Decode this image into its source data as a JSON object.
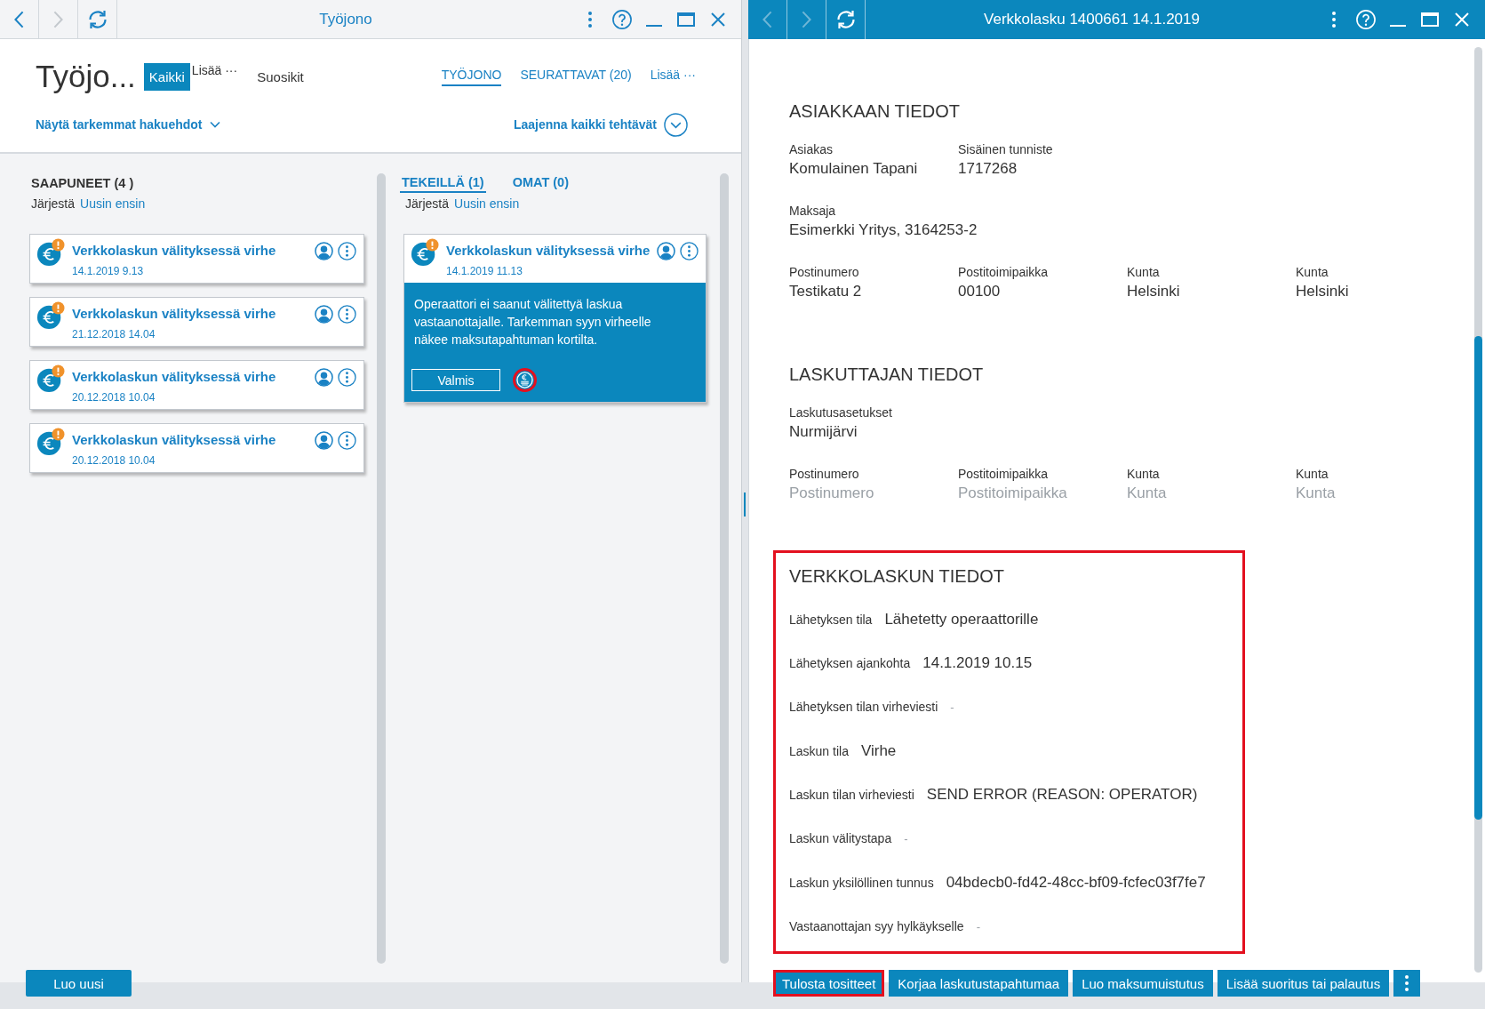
{
  "queue_window": {
    "title_bar": {
      "title": "Työjono",
      "active": false,
      "nav": [
        {
          "kind": "back",
          "disabled": false
        },
        {
          "kind": "forward",
          "disabled": true
        }
      ]
    },
    "header": {
      "title": "Työjo...",
      "view_tabs": [
        {
          "kind": "tab",
          "label": "Kaikki",
          "selected": true
        },
        {
          "kind": "more",
          "label": "Lisää ···",
          "selected": false
        },
        {
          "kind": "tab",
          "label": "Suosikit",
          "selected": false
        }
      ],
      "queue_tabs": [
        {
          "label": "TYÖJONO",
          "selected": true
        },
        {
          "label": "SEURATTAVAT (20)",
          "selected": false
        },
        {
          "label": "Lisää ···",
          "selected": false
        }
      ],
      "filter_link": "Näytä tarkemmat hakuehdot",
      "expand_link": "Laajenna kaikki tehtävät"
    },
    "columns": [
      {
        "kind": "heading",
        "heading": "SAAPUNEET (4 )",
        "sort_label": "Järjestä",
        "sort_value": "Uusin ensin",
        "cards": [
          {
            "title": "Verkkolaskun välityksessä virhe",
            "date": "14.1.2019 9.13"
          },
          {
            "title": "Verkkolaskun välityksessä virhe",
            "date": "21.12.2018 14.04"
          },
          {
            "title": "Verkkolaskun välityksessä virhe",
            "date": "20.12.2018 10.04"
          },
          {
            "title": "Verkkolaskun välityksessä virhe",
            "date": "20.12.2018 10.04"
          }
        ]
      },
      {
        "kind": "tabs",
        "tabs": [
          {
            "label": "TEKEILLÄ (1)",
            "selected": true
          },
          {
            "label": "OMAT (0)",
            "selected": false
          }
        ],
        "sort_label": "Järjestä",
        "sort_value": "Uusin ensin",
        "cards": [
          {
            "title": "Verkkolaskun välityksessä virhe",
            "date": "14.1.2019 11.13",
            "expanded": true,
            "message": "Operaattori ei saanut välitettyä laskua vastaanottajalle. Tarkemman syyn virheelle näkee maksutapahtuman kortilta.",
            "done_button": "Valmis",
            "action_highlighted": true
          }
        ]
      }
    ],
    "new_button": "Luo uusi"
  },
  "detail_window": {
    "title_bar": {
      "title": "Verkkolasku 1400661 14.1.2019",
      "active": true,
      "nav": [
        {
          "kind": "back",
          "disabled": true
        },
        {
          "kind": "forward",
          "disabled": true
        }
      ]
    },
    "sections": [
      {
        "kind": "grid",
        "title": "ASIAKKAAN TIEDOT",
        "highlighted": false,
        "rows": [
          [
            {
              "kind": "text",
              "label": "Asiakas",
              "value": "Komulainen Tapani"
            },
            {
              "kind": "text",
              "label": "Sisäinen tunniste",
              "value": "1717268"
            }
          ],
          [
            {
              "kind": "text",
              "label": "Maksaja",
              "value": "Esimerkki Yritys, 3164253-2"
            }
          ],
          [
            {
              "kind": "text",
              "label": "Postinumero",
              "value": "Testikatu 2"
            },
            {
              "kind": "text",
              "label": "Postitoimipaikka",
              "value": "00100"
            },
            {
              "kind": "text",
              "label": "Kunta",
              "value": "Helsinki"
            },
            {
              "kind": "text",
              "label": "Kunta",
              "value": "Helsinki"
            }
          ]
        ]
      },
      {
        "kind": "grid",
        "title": "LASKUTTAJAN TIEDOT",
        "highlighted": false,
        "rows": [
          [
            {
              "kind": "text",
              "label": "Laskutusasetukset",
              "value": "Nurmijärvi"
            }
          ],
          [
            {
              "kind": "input",
              "label": "Postinumero",
              "placeholder": "Postinumero"
            },
            {
              "kind": "input",
              "label": "Postitoimipaikka",
              "placeholder": "Postitoimipaikka"
            },
            {
              "kind": "input",
              "label": "Kunta",
              "placeholder": "Kunta"
            },
            {
              "kind": "input",
              "label": "Kunta",
              "placeholder": "Kunta"
            }
          ]
        ]
      },
      {
        "kind": "list",
        "title": "VERKKOLASKUN TIEDOT",
        "highlighted": true,
        "fields": [
          {
            "kind": "text",
            "label": "Lähetyksen tila",
            "value": "Lähetetty operaattorille"
          },
          {
            "kind": "text",
            "label": "Lähetyksen ajankohta",
            "value": "14.1.2019 10.15"
          },
          {
            "kind": "blank",
            "label": "Lähetyksen tilan virheviesti",
            "value": "-"
          },
          {
            "kind": "text",
            "label": "Laskun tila",
            "value": "Virhe"
          },
          {
            "kind": "text",
            "label": "Laskun tilan virheviesti",
            "value": "SEND ERROR (REASON: OPERATOR)"
          },
          {
            "kind": "blank",
            "label": "Laskun välitystapa",
            "value": "-"
          },
          {
            "kind": "text",
            "label": "Laskun yksilöllinen tunnus",
            "value": "04bdecb0-fd42-48cc-bf09-fcfec03f7fe7"
          },
          {
            "kind": "blank",
            "label": "Vastaanottajan syy hylkäykselle",
            "value": "-"
          }
        ]
      }
    ],
    "actions": [
      {
        "label": "Tulosta tositteet",
        "highlighted": true
      },
      {
        "label": "Korjaa laskutustapahtumaa",
        "highlighted": false
      },
      {
        "label": "Luo maksumuistutus",
        "highlighted": false
      },
      {
        "label": "Lisää suoritus tai palautus",
        "highlighted": false
      }
    ]
  }
}
